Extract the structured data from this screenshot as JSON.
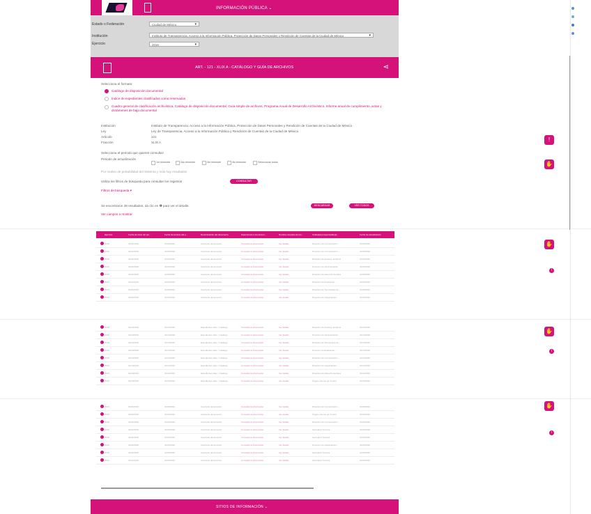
{
  "header": {
    "title": "INFORMACIÓN PÚBLICA ⌄"
  },
  "filters": {
    "estado_label": "Estado o Federación",
    "estado_value": "Ciudad de México",
    "institucion_label": "Institución",
    "institucion_value": "Instituto de Transparencia, Acceso a la Información Pública, Protección de Datos Personales y Rendición de Cuentas de la Ciudad de México",
    "ejercicio_label": "Ejercicio",
    "ejercicio_value": "2016"
  },
  "band": {
    "title": "ART. - 121 - XLIX A - CATÁLOGO Y GUÍA DE ARCHIVOS"
  },
  "formato": {
    "label": "Selecciona el formato:",
    "options": [
      "Catálogo de disposición documental",
      "Índice de expedientes clasificados como reservados",
      "Cuadro general de clasificación archivística, Catálogo de disposición documental, Guía simple de archivos, Programa Anual de Desarrollo Archivístico, Informe anual de cumplimiento, actas y dictámenes de baja documental"
    ]
  },
  "info": [
    {
      "k": "Institución",
      "v": "Instituto de Transparencia, Acceso a la Información Pública, Protección de Datos Personales y Rendición de Cuentas de la Ciudad de México"
    },
    {
      "k": "Ley",
      "v": "Ley de Transparencia, Acceso a la Información Pública y Rendición de Cuentas de la Ciudad de México"
    },
    {
      "k": "Artículo",
      "v": "121"
    },
    {
      "k": "Fracción",
      "v": "XLIX A"
    }
  ],
  "periodo": {
    "label": "Selecciona el periodo que quieres consultar:",
    "sublabel": "Periodo de actualización",
    "options": [
      "1er trimestre",
      "2do trimestre",
      "3er trimestre",
      "4to trimestre",
      "Seleccionar todos"
    ]
  },
  "note": "Por motivo de portabilidad del Sistema y más hay resultados",
  "filter_hint": "Utiliza los filtros de búsqueda para consultar los registros",
  "consult_btn": "CONSULTAR",
  "filtros_link": "Filtros de búsqueda ▾",
  "results": {
    "text": "Se encontraron 39 resultados, da clic en ❶ para ver el detalle.",
    "descargar": "DESCARGAR",
    "ver_todos": "VER TODOS"
  },
  "ver_campos": "Ver campos a mostrar",
  "table": {
    "headers": [
      "Ejercicio",
      "Fecha de inicio del per…",
      "Fecha de término del p…",
      "Denominación del documento",
      "Hipervínculo a los docum…",
      "Nombre completo de los…",
      "Unidad(es) responsable(s)…",
      "Fecha de actualización",
      "…"
    ],
    "rows_a": [
      [
        "2016",
        "01/01/2016",
        "31/03/2016",
        "Inventario documental",
        "Consultar la información",
        "Ver detalle",
        "Dirección de Comunicación…",
        "31/03/2016"
      ],
      [
        "2016",
        "01/01/2016",
        "31/03/2016",
        "Inventario documental",
        "Consultar la información",
        "Ver detalle",
        "Dirección de Comunicación…",
        "31/03/2016"
      ],
      [
        "2016",
        "01/01/2016",
        "31/03/2016",
        "Inventario documental",
        "Consultar la información",
        "Ver detalle",
        "Dirección de Asuntos Jurídicos",
        "31/03/2016"
      ],
      [
        "2016",
        "01/01/2016",
        "31/03/2016",
        "Inventario documental",
        "Consultar la información",
        "Ver detalle",
        "Dirección de Administración",
        "31/03/2016"
      ],
      [
        "2016",
        "01/01/2016",
        "31/03/2016",
        "Inventario documental",
        "Consultar la información",
        "Ver detalle",
        "Dirección de Datos Personales",
        "31/03/2016"
      ],
      [
        "2016",
        "01/01/2016",
        "31/03/2016",
        "Inventario documental",
        "Consultar la información",
        "Ver detalle",
        "Dirección de Evaluación…",
        "31/03/2016"
      ],
      [
        "2016",
        "01/01/2016",
        "31/03/2016",
        "Inventario documental",
        "Consultar la información",
        "Ver detalle",
        "Dirección de Tecnologías de…",
        "31/03/2016"
      ],
      [
        "2016",
        "01/01/2016",
        "31/03/2016",
        "Inventario documental",
        "Consultar la información",
        "Ver detalle",
        "Dirección de Capacitación…",
        "31/03/2016"
      ]
    ],
    "rows_b": [
      [
        "2016",
        "01/10/2016",
        "31/12/2016",
        "Expedientes clasi. / Catálogo",
        "Consultar la información",
        "Ver detalle",
        "Dirección de Asuntos Jurídicos",
        "31/12/2016"
      ],
      [
        "2016",
        "01/10/2016",
        "31/12/2016",
        "Expedientes clasi. / Catálogo",
        "Consultar la información",
        "Ver detalle",
        "Dirección de Administración",
        "31/12/2016"
      ],
      [
        "2016",
        "01/10/2016",
        "31/12/2016",
        "Expedientes clasi. / Catálogo",
        "Consultar la información",
        "Ver detalle",
        "Dirección de Tecnologías de…",
        "31/12/2016"
      ],
      [
        "2016",
        "01/10/2016",
        "31/12/2016",
        "Expedientes clasi. / Catálogo",
        "Consultar la información",
        "Ver detalle",
        "Dirección de Evaluación…",
        "31/12/2016"
      ],
      [
        "2016",
        "01/10/2016",
        "31/12/2016",
        "Expedientes clasi. / Catálogo",
        "Consultar la información",
        "Ver detalle",
        "Dirección de Comunicación…",
        "31/12/2016"
      ],
      [
        "2016",
        "01/10/2016",
        "31/12/2016",
        "Expedientes clasi. / Catálogo",
        "Consultar la información",
        "Ver detalle",
        "Dirección de Capacitación…",
        "31/12/2016"
      ],
      [
        "2016",
        "01/10/2016",
        "31/12/2016",
        "Expedientes clasi. / Catálogo",
        "Consultar la información",
        "Ver detalle",
        "Dirección de Datos Personales",
        "31/12/2016"
      ],
      [
        "2016",
        "01/10/2016",
        "31/12/2016",
        "Expedientes clasi. / Catálogo",
        "Consultar la información",
        "Ver detalle",
        "Órgano Interno de Control",
        "31/12/2016"
      ]
    ],
    "rows_c": [
      [
        "2016",
        "01/01/2016",
        "31/03/2016",
        "Inventario documental",
        "Consultar la información",
        "Ver detalle",
        "Dirección de Comunicación…",
        "31/03/2016"
      ],
      [
        "2016",
        "01/01/2016",
        "31/03/2016",
        "Inventario documental",
        "Consultar la información",
        "Ver detalle",
        "Órgano Interno de Control",
        "31/03/2016"
      ],
      [
        "2016",
        "01/01/2016",
        "31/03/2016",
        "Inventario documental",
        "Consultar la información",
        "Ver detalle",
        "Dirección de Comunicación…",
        "31/03/2016"
      ],
      [
        "2016",
        "01/01/2016",
        "31/03/2016",
        "Inventario documental",
        "Consultar la información",
        "Ver detalle",
        "Secretaría Técnica",
        "31/03/2016"
      ],
      [
        "2016",
        "01/01/2016",
        "31/03/2016",
        "Inventario documental",
        "Consultar la información",
        "Ver detalle",
        "Secretaría Técnica",
        "31/03/2016"
      ],
      [
        "2016",
        "01/01/2016",
        "31/03/2016",
        "Inventario documental",
        "Consultar la información",
        "Ver detalle",
        "Dirección de Capacitación…",
        "31/03/2016"
      ],
      [
        "2016",
        "01/01/2016",
        "31/03/2016",
        "Inventario documental",
        "Consultar la información",
        "Ver detalle",
        "Secretaría Técnica",
        "31/03/2016"
      ],
      [
        "2016",
        "01/01/2016",
        "31/03/2016",
        "Inventario documental",
        "Consultar la información",
        "Ver detalle",
        "Secretaría Técnica",
        "31/03/2016"
      ]
    ]
  },
  "footer": {
    "title": "SITIOS DE INFORMACIÓN ⌄"
  },
  "colors": {
    "brand": "#d5117a",
    "filters_bg": "#d8d8d8"
  },
  "side_icons": [
    "alert-icon",
    "hand-icon",
    "hand-icon",
    "info-icon"
  ]
}
